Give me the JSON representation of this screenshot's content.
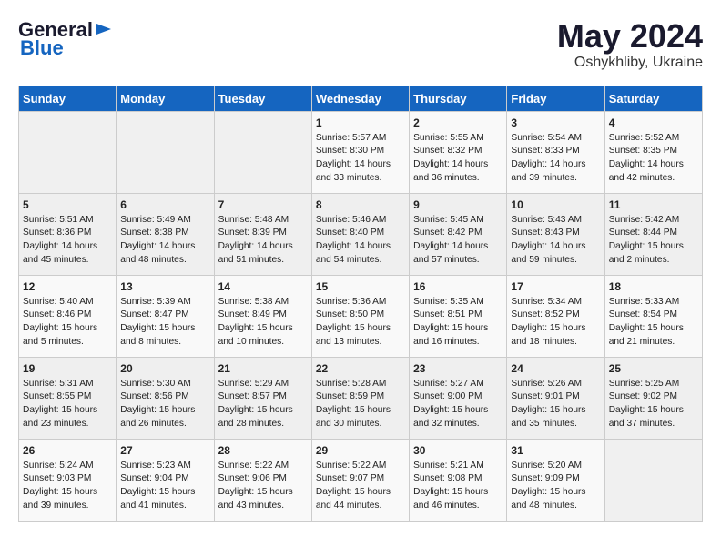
{
  "logo": {
    "line1": "General",
    "line2": "Blue",
    "arrow_unicode": "▶"
  },
  "title": "May 2024",
  "location": "Oshykhliby, Ukraine",
  "days_of_week": [
    "Sunday",
    "Monday",
    "Tuesday",
    "Wednesday",
    "Thursday",
    "Friday",
    "Saturday"
  ],
  "weeks": [
    [
      {
        "num": "",
        "info": ""
      },
      {
        "num": "",
        "info": ""
      },
      {
        "num": "",
        "info": ""
      },
      {
        "num": "1",
        "info": "Sunrise: 5:57 AM\nSunset: 8:30 PM\nDaylight: 14 hours\nand 33 minutes."
      },
      {
        "num": "2",
        "info": "Sunrise: 5:55 AM\nSunset: 8:32 PM\nDaylight: 14 hours\nand 36 minutes."
      },
      {
        "num": "3",
        "info": "Sunrise: 5:54 AM\nSunset: 8:33 PM\nDaylight: 14 hours\nand 39 minutes."
      },
      {
        "num": "4",
        "info": "Sunrise: 5:52 AM\nSunset: 8:35 PM\nDaylight: 14 hours\nand 42 minutes."
      }
    ],
    [
      {
        "num": "5",
        "info": "Sunrise: 5:51 AM\nSunset: 8:36 PM\nDaylight: 14 hours\nand 45 minutes."
      },
      {
        "num": "6",
        "info": "Sunrise: 5:49 AM\nSunset: 8:38 PM\nDaylight: 14 hours\nand 48 minutes."
      },
      {
        "num": "7",
        "info": "Sunrise: 5:48 AM\nSunset: 8:39 PM\nDaylight: 14 hours\nand 51 minutes."
      },
      {
        "num": "8",
        "info": "Sunrise: 5:46 AM\nSunset: 8:40 PM\nDaylight: 14 hours\nand 54 minutes."
      },
      {
        "num": "9",
        "info": "Sunrise: 5:45 AM\nSunset: 8:42 PM\nDaylight: 14 hours\nand 57 minutes."
      },
      {
        "num": "10",
        "info": "Sunrise: 5:43 AM\nSunset: 8:43 PM\nDaylight: 14 hours\nand 59 minutes."
      },
      {
        "num": "11",
        "info": "Sunrise: 5:42 AM\nSunset: 8:44 PM\nDaylight: 15 hours\nand 2 minutes."
      }
    ],
    [
      {
        "num": "12",
        "info": "Sunrise: 5:40 AM\nSunset: 8:46 PM\nDaylight: 15 hours\nand 5 minutes."
      },
      {
        "num": "13",
        "info": "Sunrise: 5:39 AM\nSunset: 8:47 PM\nDaylight: 15 hours\nand 8 minutes."
      },
      {
        "num": "14",
        "info": "Sunrise: 5:38 AM\nSunset: 8:49 PM\nDaylight: 15 hours\nand 10 minutes."
      },
      {
        "num": "15",
        "info": "Sunrise: 5:36 AM\nSunset: 8:50 PM\nDaylight: 15 hours\nand 13 minutes."
      },
      {
        "num": "16",
        "info": "Sunrise: 5:35 AM\nSunset: 8:51 PM\nDaylight: 15 hours\nand 16 minutes."
      },
      {
        "num": "17",
        "info": "Sunrise: 5:34 AM\nSunset: 8:52 PM\nDaylight: 15 hours\nand 18 minutes."
      },
      {
        "num": "18",
        "info": "Sunrise: 5:33 AM\nSunset: 8:54 PM\nDaylight: 15 hours\nand 21 minutes."
      }
    ],
    [
      {
        "num": "19",
        "info": "Sunrise: 5:31 AM\nSunset: 8:55 PM\nDaylight: 15 hours\nand 23 minutes."
      },
      {
        "num": "20",
        "info": "Sunrise: 5:30 AM\nSunset: 8:56 PM\nDaylight: 15 hours\nand 26 minutes."
      },
      {
        "num": "21",
        "info": "Sunrise: 5:29 AM\nSunset: 8:57 PM\nDaylight: 15 hours\nand 28 minutes."
      },
      {
        "num": "22",
        "info": "Sunrise: 5:28 AM\nSunset: 8:59 PM\nDaylight: 15 hours\nand 30 minutes."
      },
      {
        "num": "23",
        "info": "Sunrise: 5:27 AM\nSunset: 9:00 PM\nDaylight: 15 hours\nand 32 minutes."
      },
      {
        "num": "24",
        "info": "Sunrise: 5:26 AM\nSunset: 9:01 PM\nDaylight: 15 hours\nand 35 minutes."
      },
      {
        "num": "25",
        "info": "Sunrise: 5:25 AM\nSunset: 9:02 PM\nDaylight: 15 hours\nand 37 minutes."
      }
    ],
    [
      {
        "num": "26",
        "info": "Sunrise: 5:24 AM\nSunset: 9:03 PM\nDaylight: 15 hours\nand 39 minutes."
      },
      {
        "num": "27",
        "info": "Sunrise: 5:23 AM\nSunset: 9:04 PM\nDaylight: 15 hours\nand 41 minutes."
      },
      {
        "num": "28",
        "info": "Sunrise: 5:22 AM\nSunset: 9:06 PM\nDaylight: 15 hours\nand 43 minutes."
      },
      {
        "num": "29",
        "info": "Sunrise: 5:22 AM\nSunset: 9:07 PM\nDaylight: 15 hours\nand 44 minutes."
      },
      {
        "num": "30",
        "info": "Sunrise: 5:21 AM\nSunset: 9:08 PM\nDaylight: 15 hours\nand 46 minutes."
      },
      {
        "num": "31",
        "info": "Sunrise: 5:20 AM\nSunset: 9:09 PM\nDaylight: 15 hours\nand 48 minutes."
      },
      {
        "num": "",
        "info": ""
      }
    ]
  ]
}
